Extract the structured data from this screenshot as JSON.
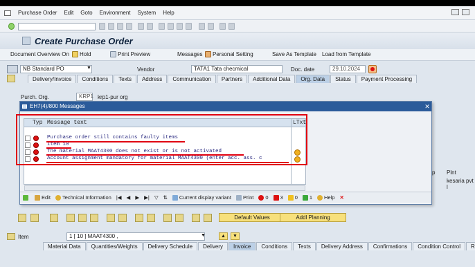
{
  "menu": [
    "Purchase Order",
    "Edit",
    "Goto",
    "Environment",
    "System",
    "Help"
  ],
  "title": "Create Purchase Order",
  "app_toolbar": {
    "doc_overview": "Document Overview On",
    "hold": "Hold",
    "print_preview": "Print Preview",
    "messages": "Messages",
    "personal_setting": "Personal Setting",
    "save_as_template": "Save As Template",
    "load_from_template": "Load from Template"
  },
  "header": {
    "doc_type": "NB Standard PO",
    "vendor_label": "Vendor",
    "vendor_value": "TATA1 Tata checmical",
    "doc_date_label": "Doc. date",
    "doc_date_value": "29.10.2024"
  },
  "header_tabs": [
    "Delivery/Invoice",
    "Conditions",
    "Texts",
    "Address",
    "Communication",
    "Partners",
    "Additional Data",
    "Org. Data",
    "Status",
    "Payment Processing"
  ],
  "org": {
    "purch_org_label": "Purch. Org.",
    "purch_org_code": "KRP1",
    "purch_org_name": "krp1-pur org"
  },
  "dialog": {
    "title": "EH7(4)/800 Messages",
    "col_typ": "Typ",
    "col_msg": "Message text",
    "col_ltxt": "LTxt",
    "rows": [
      {
        "text": "Purchase order still contains faulty items",
        "longtext": false
      },
      {
        "text": "Item 10",
        "longtext": false
      },
      {
        "text": "The material MAAT4300 does not exist or is not activated",
        "longtext": true
      },
      {
        "text": "Account assignment mandatory for material MAAT4300 (enter acc. ass. c",
        "longtext": true
      }
    ],
    "buttons": {
      "edit": "Edit",
      "technical": "Technical Information",
      "current_variant": "Current display variant",
      "print": "Print",
      "count_red": "0",
      "count_yellow": "3",
      "count_warn": "0",
      "count_green": "1",
      "help": "Help"
    }
  },
  "behind": {
    "col_p": "p",
    "col_plnt": "Plnt",
    "plant_value": "kesaria pvt l"
  },
  "lower": {
    "default_values": "Default Values",
    "addl_planning": "Addl Planning"
  },
  "item": {
    "label": "Item",
    "value": "1 [ 10 ] MAAT4300 ,"
  },
  "item_tabs": [
    "Material Data",
    "Quantities/Weights",
    "Delivery Schedule",
    "Delivery",
    "Invoice",
    "Conditions",
    "Texts",
    "Delivery Address",
    "Confirmations",
    "Condition Control",
    "Retail"
  ]
}
